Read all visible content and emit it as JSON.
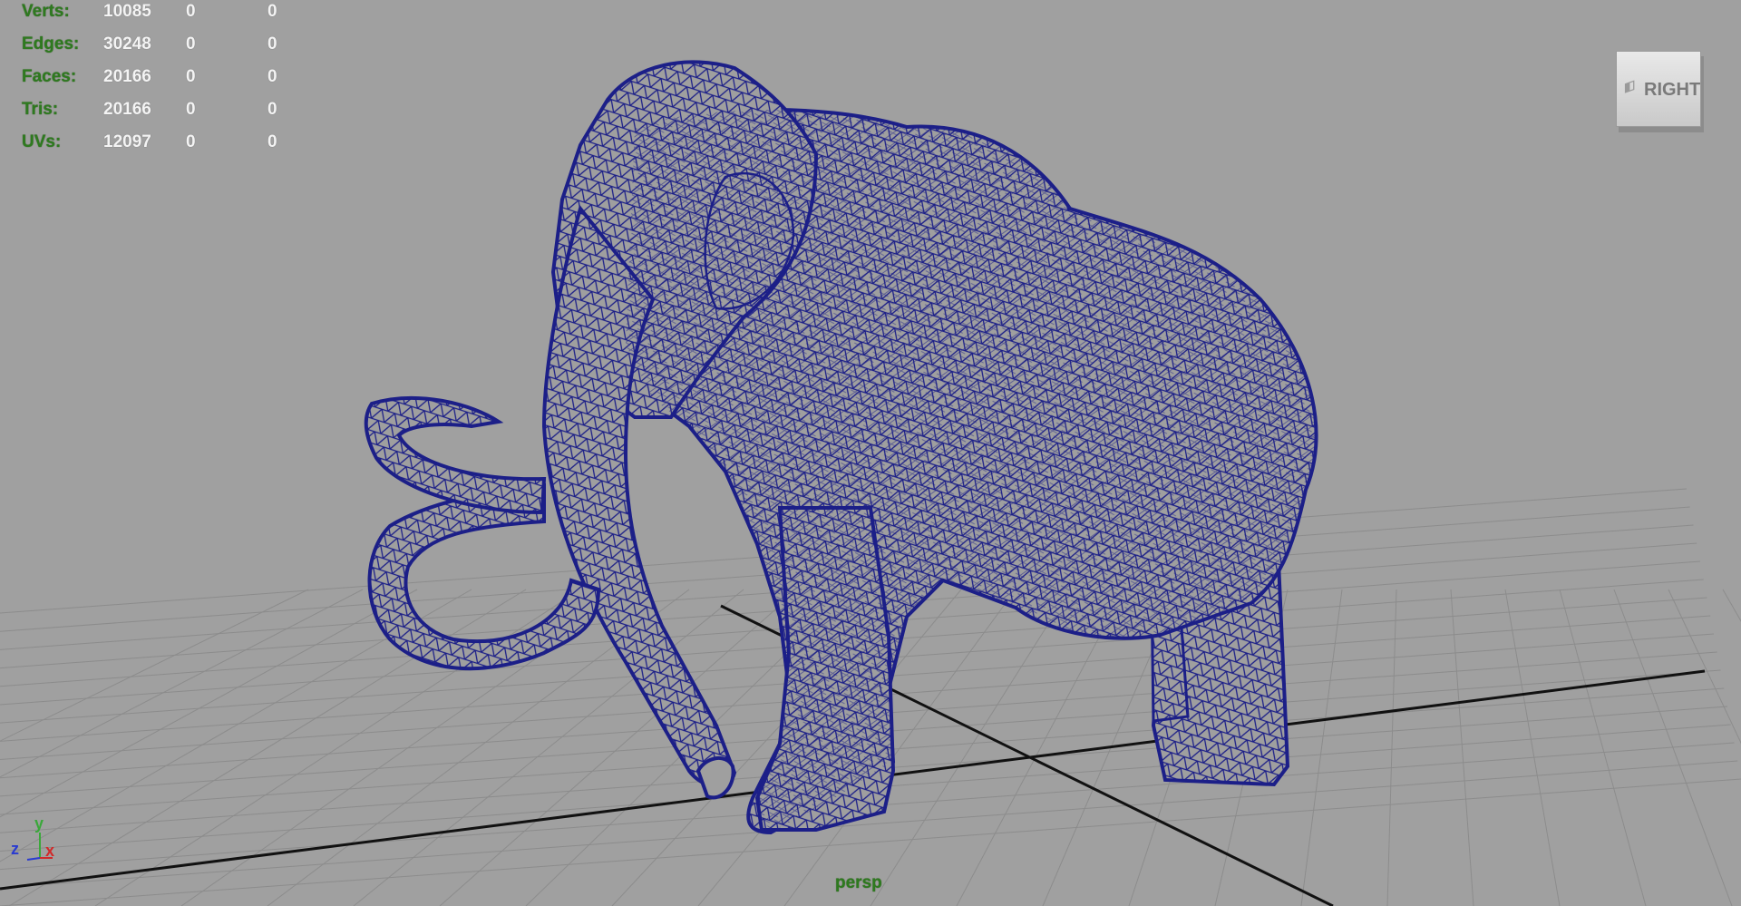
{
  "hud": {
    "rows": [
      {
        "label": "Verts:",
        "v1": "10085",
        "v2": "0",
        "v3": "0"
      },
      {
        "label": "Edges:",
        "v1": "30248",
        "v2": "0",
        "v3": "0"
      },
      {
        "label": "Faces:",
        "v1": "20166",
        "v2": "0",
        "v3": "0"
      },
      {
        "label": "Tris:",
        "v1": "20166",
        "v2": "0",
        "v3": "0"
      },
      {
        "label": "UVs:",
        "v1": "12097",
        "v2": "0",
        "v3": "0"
      }
    ]
  },
  "viewcube": {
    "label": "RIGHT"
  },
  "camera": {
    "name": "persp"
  },
  "axis": {
    "x": "x",
    "y": "y",
    "z": "z"
  },
  "colors": {
    "background": "#a0a0a0",
    "grid": "#8c8c8c",
    "axis_line": "#111111",
    "wireframe": "#1c1f88",
    "hud_label": "#2e7a1f",
    "hud_value": "#f4f4f4"
  },
  "icons": {
    "viewcube": "view-cube-icon",
    "axis": "axis-indicator-icon"
  }
}
